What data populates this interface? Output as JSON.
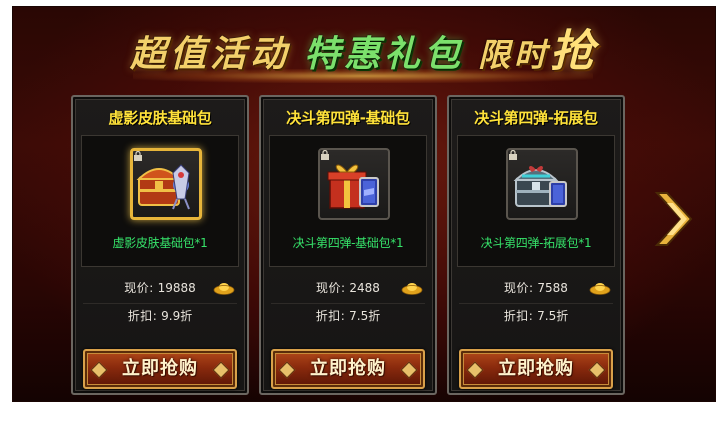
{
  "banner": {
    "part1": "超值活动",
    "part2": "特惠礼包",
    "part3": "限时",
    "part4": "抢"
  },
  "packs": [
    {
      "title": "虚影皮肤基础包",
      "item_name": "虚影皮肤基础包*1",
      "price_label": "现价:",
      "price": "19888",
      "discount_label": "折扣:",
      "discount": "9.9折",
      "buy_label": "立即抢购",
      "currency_icon": "gold-ingot-icon",
      "highlight": true
    },
    {
      "title": "决斗第四弹-基础包",
      "item_name": "决斗第四弹-基础包*1",
      "price_label": "现价:",
      "price": "2488",
      "discount_label": "折扣:",
      "discount": "7.5折",
      "buy_label": "立即抢购",
      "currency_icon": "gold-ingot-icon",
      "highlight": false
    },
    {
      "title": "决斗第四弹-拓展包",
      "item_name": "决斗第四弹-拓展包*1",
      "price_label": "现价:",
      "price": "7588",
      "discount_label": "折扣:",
      "discount": "7.5折",
      "buy_label": "立即抢购",
      "currency_icon": "gold-ingot-icon",
      "highlight": false
    }
  ],
  "colors": {
    "title_yellow": "#ffe23a",
    "item_green": "#36e36a",
    "frame_gold": "#e7b53a"
  }
}
